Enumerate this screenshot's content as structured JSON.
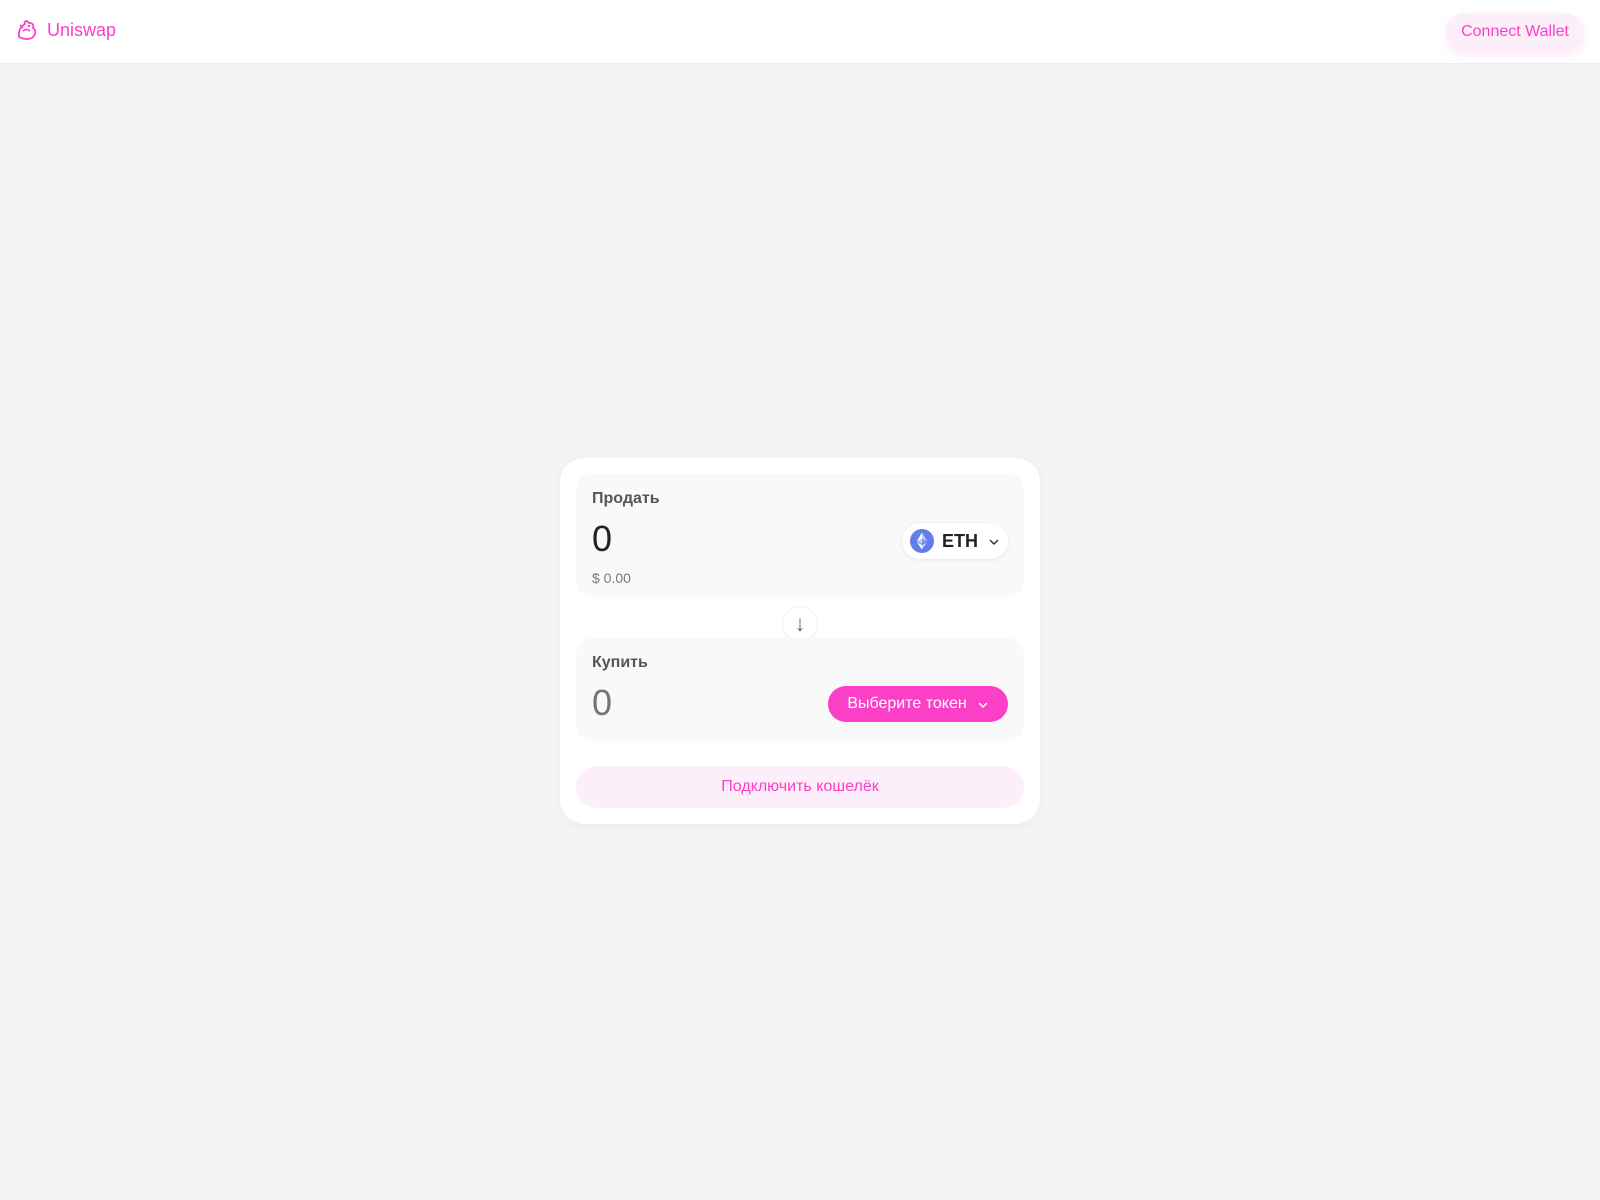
{
  "header": {
    "brand": "Uniswap",
    "connect_button": "Connect Wallet"
  },
  "swap": {
    "sell": {
      "label": "Продать",
      "amount": "0",
      "usd_value": "$ 0.00",
      "token": "ETH"
    },
    "buy": {
      "label": "Купить",
      "amount_placeholder": "0",
      "select_token_label": "Выберите токен"
    },
    "switch_icon": "↓",
    "connect_button": "Подключить кошелёк"
  },
  "colors": {
    "accent": "#fc3fc7",
    "accent_soft": "#fdeff9",
    "background": "#f4f4f4",
    "eth": "#627eea"
  },
  "icons": {
    "logo": "uniswap-unicorn-icon",
    "eth": "eth-icon",
    "chevron": "chevron-down-icon",
    "switch": "arrow-down-icon"
  }
}
